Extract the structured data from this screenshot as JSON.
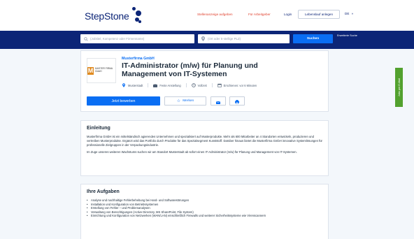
{
  "header": {
    "logo_text": "StepStone",
    "nav": {
      "post_job": "Stellenanzeige aufgeben",
      "employers": "Für Arbeitgeber",
      "login": "Login",
      "cv": "Lebenslauf anlegen",
      "lang": "DE",
      "lang_chevron": "»"
    },
    "colors": {
      "brand": "#0c2577",
      "accent": "#e0412e",
      "primary": "#0a6ef3"
    }
  },
  "search": {
    "what_placeholder": "(Jobtitel, Kompetenz oder Firmenname)",
    "where_placeholder": "(Ort oder 5-stellige PLZ)",
    "button_label": "Suchen",
    "advanced_label": "Erweiterte Suche",
    "what_icon": "search-icon",
    "where_icon": "location-pin-icon"
  },
  "job": {
    "company": "Musterfirma GmbH",
    "title": "IT-Administrator (m/w) für Planung und Management von IT-Systemen",
    "logo_letter": "M",
    "logo_text": "MUSTER FIRMA GmbH",
    "location": "Musterstadt",
    "employment_type": "Feste Anstellung",
    "worktime": "Vollzeit",
    "published": "Erschienen: vor 6 Minuten",
    "apply_label": "Jetzt bewerben",
    "save_label": "Merken"
  },
  "side_tab": {
    "label": "Jobs per E-Mail"
  },
  "einleitung": {
    "title": "Einleitung",
    "p1": "Musterfirma GmbH ist ein mittelständisch agierendes Unternehmen und spezialisiert auf Musterprodukte. Mehr als 600 Mitarbeiter an 4 Standorten entwickeln, produzieren und vertreiben Musterprodukte. Ergänzt wird das Portfolio durch Produkte für das Spezialsegment Kunststoff. Darüber hinaus bietet die Musterfirma GmbH innovative Systemlösungen für professionelle Zielgruppen in der Verpackungsindustrie.",
    "p2": "Im Zuge unseres weiteren Wachstums suchen wir am Standort Musterstadt ab sofort einen IT-Administrator (m/w) für Planung und Management von IT-Systemen."
  },
  "aufgaben": {
    "title": "Ihre Aufgaben",
    "items": [
      "Analyse und nachhaltige Fehlerbehebung bei Hard- und Softwarestörungen",
      "Installation und Konfiguration von Betriebssystemen",
      "Erstellung von Fehler – und Problemanalysen",
      "Verwaltung von Berechtigungen (Active Directory, MS SharePoint, File System)",
      "Einrichtung und Konfiguration von Netzwerken (WAN/LAN) einschließlich Firewalls und weiterer Sicherheitssysteme wie Virenscannern"
    ]
  }
}
